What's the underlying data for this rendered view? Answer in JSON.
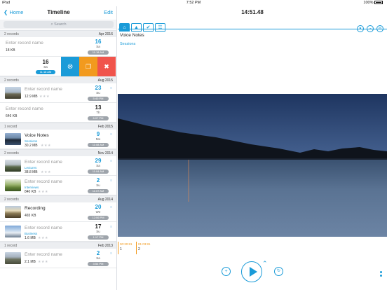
{
  "status": {
    "carrier": "iPad",
    "time": "7:52 PM",
    "battery": "100%"
  },
  "left": {
    "back": "Home",
    "title": "Timeline",
    "edit": "Edit",
    "search_placeholder": "Search"
  },
  "sections": [
    {
      "count": "2 records",
      "date": "Apr 2016"
    },
    {
      "count": "2 records",
      "date": "Aug 2015"
    },
    {
      "count": "1 record",
      "date": "Feb 2015"
    },
    {
      "count": "2 records",
      "date": "Nov 2014"
    },
    {
      "count": "2 records",
      "date": "Aug 2014"
    },
    {
      "count": "1 record",
      "date": "Feb 2013"
    }
  ],
  "rows": [
    {
      "title": "Enter record name",
      "size": "18 KB",
      "day": "16",
      "weekday": "Sa",
      "time": "11:18 AM"
    },
    {
      "day": "16",
      "weekday": "Sa",
      "time": "11:18 AM"
    },
    {
      "title": "Enter record name",
      "size": "12.9 MB",
      "day": "23",
      "weekday": "Su",
      "time": "5:40 PM"
    },
    {
      "title": "Enter record name",
      "size": "646 KB",
      "day": "13",
      "weekday": "Th",
      "time": "6:07 PM"
    },
    {
      "title": "Voice Notes",
      "sub": "Sessions",
      "size": "30.2 MB",
      "day": "9",
      "weekday": "Mo",
      "time": "11:08 AM"
    },
    {
      "title": "Enter record name",
      "sub": "Lectures",
      "size": "38.8 MB",
      "day": "29",
      "weekday": "Sa",
      "time": "11:04 AM"
    },
    {
      "title": "Enter record name",
      "sub": "Interviews",
      "size": "840 KB",
      "day": "2",
      "weekday": "Su",
      "time": "11:07 AM"
    },
    {
      "title": "Recording",
      "size": "465 KB",
      "day": "20",
      "weekday": "We",
      "time": "12:06 PM"
    },
    {
      "title": "Enter record name",
      "sub": "Business",
      "size": "1.6 MB",
      "day": "17",
      "weekday": "Su",
      "time": "1:17 PM"
    },
    {
      "title": "Enter record name",
      "size": "2.1 MB",
      "day": "2",
      "weekday": "Sa",
      "time": "3:54 PM"
    }
  ],
  "right": {
    "clock": "14:51.48",
    "record_title": "Voice Notes",
    "record_folder": "Sessions"
  },
  "markers": [
    {
      "time": "00:30:81",
      "num": "1"
    },
    {
      "time": "01:03:81",
      "num": "2"
    }
  ],
  "colors": {
    "accent": "#1a9bd8",
    "orange": "#f29a1e",
    "red": "#f0544c"
  }
}
